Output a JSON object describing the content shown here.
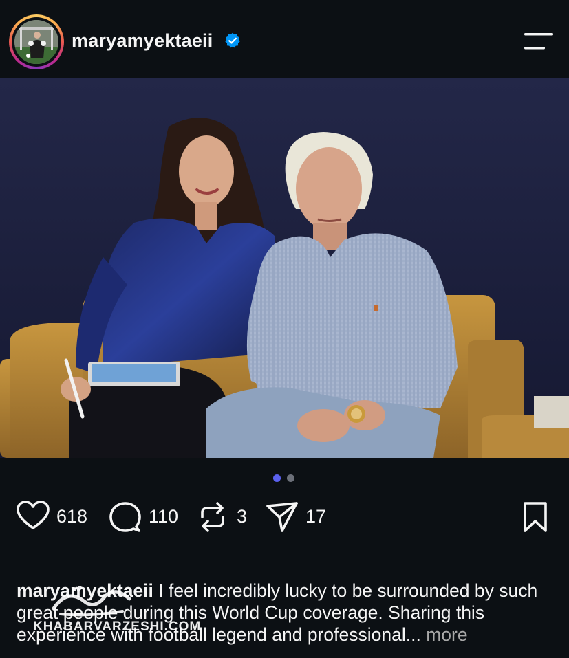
{
  "header": {
    "username": "maryamyektaeii",
    "verified": true,
    "menu_icon": "hamburger-menu-icon"
  },
  "carousel": {
    "current_index": 1,
    "total": 2,
    "active_color": "#5b61ef",
    "inactive_color": "#6b6f78"
  },
  "actions": {
    "likes": "618",
    "comments": "110",
    "reposts": "3",
    "shares": "17"
  },
  "caption": {
    "username": "maryamyektaeii",
    "text": " I feel incredibly lucky to be surrounded by such great people during this World Cup coverage. Sharing this experience with football legend and professional...",
    "more": "more"
  },
  "watermark": {
    "text": "KHABARVARZESHI.COM"
  },
  "colors": {
    "background": "#0c1014",
    "verified": "#0095f6",
    "sofa": "#b8893c",
    "wall": "#1b1f3a"
  }
}
